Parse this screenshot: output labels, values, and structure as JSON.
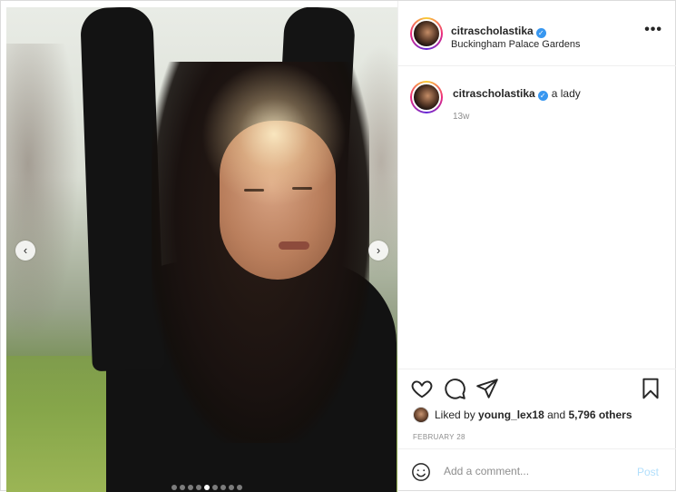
{
  "post": {
    "username": "citrascholastika",
    "verified_icon": "verified-badge-icon",
    "location": "Buckingham Palace Gardens",
    "more_icon": "more-options-icon",
    "more_label": "•••"
  },
  "caption": {
    "username": "citrascholastika",
    "text": "a lady",
    "time": "13w"
  },
  "carousel": {
    "prev_icon": "chevron-left-icon",
    "next_icon": "chevron-right-icon",
    "prev_glyph": "‹",
    "next_glyph": "›",
    "dot_count": 9,
    "active_dot": 4
  },
  "actions": {
    "like_icon": "heart-icon",
    "comment_icon": "comment-icon",
    "share_icon": "paper-plane-icon",
    "save_icon": "bookmark-icon"
  },
  "likes": {
    "prefix": "Liked by",
    "user": "young_lex18",
    "and": "and",
    "others": "5,796 others"
  },
  "date": "FEBRUARY 28",
  "comment_box": {
    "emoji_icon": "emoji-smile-icon",
    "placeholder": "Add a comment...",
    "post_label": "Post"
  },
  "colors": {
    "verified": "#3897f0",
    "post_disabled": "#b2dffc",
    "muted_text": "#8e8e8e",
    "border": "#efefef"
  }
}
